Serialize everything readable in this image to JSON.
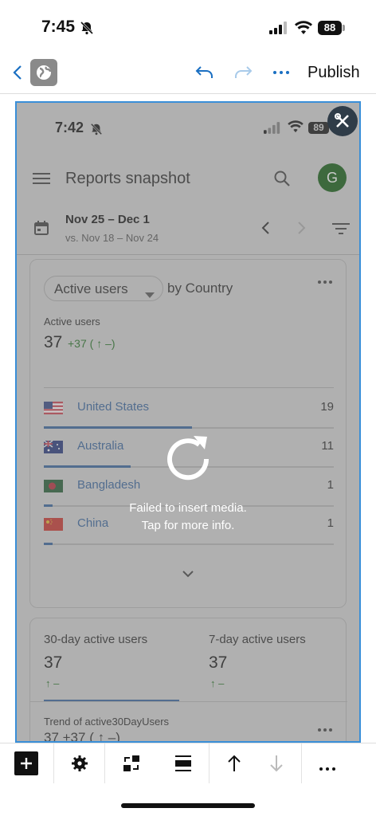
{
  "status_bar": {
    "time": "7:45",
    "battery": "88"
  },
  "editor_toolbar": {
    "publish_label": "Publish",
    "icons": [
      "chevron-left-icon",
      "globe-icon",
      "undo-icon",
      "redo-icon",
      "more-icon"
    ]
  },
  "embedded_screenshot": {
    "status_time": "7:42",
    "battery": "89",
    "app_title": "Reports snapshot",
    "avatar_initial": "G",
    "date_range": "Nov 25 – Dec 1",
    "compare_range": "vs. Nov 18 – Nov 24",
    "card1": {
      "metric_selector": "Active users",
      "by_label": "by Country",
      "metric_label": "Active users",
      "metric_value": "37",
      "metric_delta": "+37 ( ↑ –)",
      "rows": [
        {
          "country": "United States",
          "value": "19",
          "share": 0.51
        },
        {
          "country": "Australia",
          "value": "11",
          "share": 0.3
        },
        {
          "country": "Bangladesh",
          "value": "1",
          "share": 0.03
        },
        {
          "country": "China",
          "value": "1",
          "share": 0.03
        }
      ]
    },
    "card2": {
      "tile1_label": "30-day active users",
      "tile1_value": "37",
      "tile1_delta": "↑ –",
      "tile2_label": "7-day active users",
      "tile2_value": "37",
      "tile2_delta": "↑ –",
      "trend_label": "Trend of active30DayUsers",
      "trend_value": "37 +37 ( ↑ –)"
    }
  },
  "media_error": {
    "line1": "Failed to insert media.",
    "line2": "Tap for more info."
  },
  "block_toolbar": {
    "items": [
      "add-block-icon",
      "settings-icon",
      "replace-icon",
      "align-icon",
      "move-up-icon",
      "move-down-icon",
      "more-icon"
    ]
  },
  "colors": {
    "accent": "#3a8fd8",
    "link": "#3b5f8c",
    "positive": "#2e6b2e"
  }
}
